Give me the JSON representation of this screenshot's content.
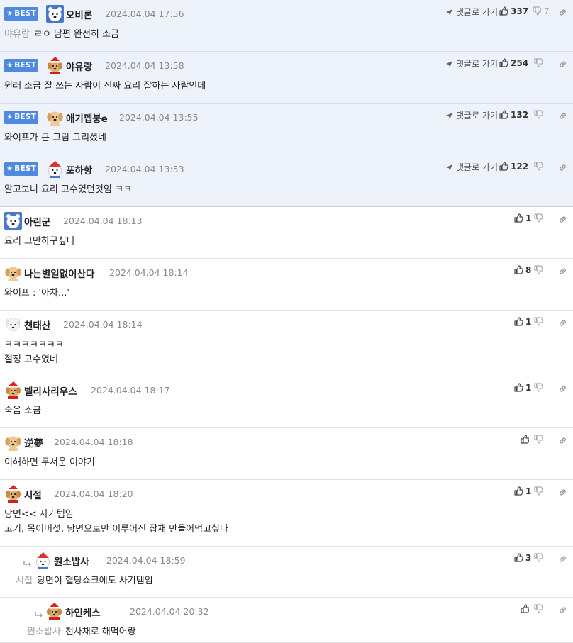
{
  "ui": {
    "best_label": "BEST",
    "goto_label": "댓글로 가기"
  },
  "colors": {
    "best_bg": "#eef3fb",
    "badge": "#4d8ae0",
    "mention": "#9a9a9a"
  },
  "best_comments": [
    {
      "nick": "오비론",
      "avatar": "bear-avatar",
      "date": "2024.04.04 17:56",
      "mention": "야유랑",
      "lines": [
        "ㄹㅇ 남편 완전히 소금"
      ],
      "up": "337",
      "down": "7"
    },
    {
      "nick": "야유랑",
      "avatar": "santa-dog-avatar",
      "date": "2024.04.04 13:58",
      "mention": "",
      "lines": [
        "원래 소금 잘 쓰는 사람이 진짜 요리 잘하는 사람인데"
      ],
      "up": "254",
      "down": ""
    },
    {
      "nick": "애기펩붕e",
      "avatar": "puppy-avatar",
      "date": "2024.04.04 13:55",
      "mention": "",
      "lines": [
        "와이프가 큰 그림 그리셨네"
      ],
      "up": "132",
      "down": ""
    },
    {
      "nick": "포하항",
      "avatar": "bear-santa-avatar",
      "date": "2024.04.04 13:53",
      "mention": "",
      "lines": [
        "알고보니 요리 고수였던것임 ㅋㅋ"
      ],
      "up": "122",
      "down": ""
    }
  ],
  "comments": [
    {
      "nick": "아린군",
      "avatar": "bear-avatar",
      "date": "2024.04.04 18:13",
      "mention": "",
      "lines": [
        "요리 그만하구싶다"
      ],
      "up": "1",
      "down": "",
      "depth": 0
    },
    {
      "nick": "나는별일없이산다",
      "avatar": "puppy-avatar",
      "date": "2024.04.04 18:14",
      "mention": "",
      "lines": [
        "와이프 : '아차...'"
      ],
      "up": "8",
      "down": "",
      "depth": 0
    },
    {
      "nick": "천태산",
      "avatar": "white-dog-avatar",
      "date": "2024.04.04 18:14",
      "mention": "",
      "lines": [
        "ㅋㅋㅋㅋㅋㅋㅋ",
        "절정 고수였네"
      ],
      "up": "1",
      "down": "",
      "depth": 0
    },
    {
      "nick": "벨리사리우스",
      "avatar": "santa-dog-avatar",
      "date": "2024.04.04 18:17",
      "mention": "",
      "lines": [
        "숙음 소금"
      ],
      "up": "1",
      "down": "",
      "depth": 0
    },
    {
      "nick": "逆夢",
      "avatar": "puppy-avatar",
      "date": "2024.04.04 18:18",
      "mention": "",
      "lines": [
        "이해하면 무서운 이야기"
      ],
      "up": "",
      "down": "",
      "depth": 0
    },
    {
      "nick": "시절",
      "avatar": "santa-dog-avatar",
      "date": "2024.04.04 18:20",
      "mention": "",
      "lines": [
        "당면<< 사기템임",
        "고기, 목이버섯, 당면으로만 이루어진 잡채 만들어먹고싶다"
      ],
      "up": "1",
      "down": "",
      "depth": 0
    },
    {
      "nick": "원소밥사",
      "avatar": "bear-santa-avatar",
      "date": "2024.04.04 18:59",
      "mention": "시절",
      "lines": [
        "당면이 혈당쇼크에도 사기템임"
      ],
      "up": "3",
      "down": "",
      "depth": 1
    },
    {
      "nick": "하인케스",
      "avatar": "santa-dog-avatar",
      "date": "2024.04.04 20:32",
      "mention": "원소밥사",
      "lines": [
        "천사채로 해먹어랑"
      ],
      "up": "",
      "down": "",
      "depth": 2
    }
  ]
}
